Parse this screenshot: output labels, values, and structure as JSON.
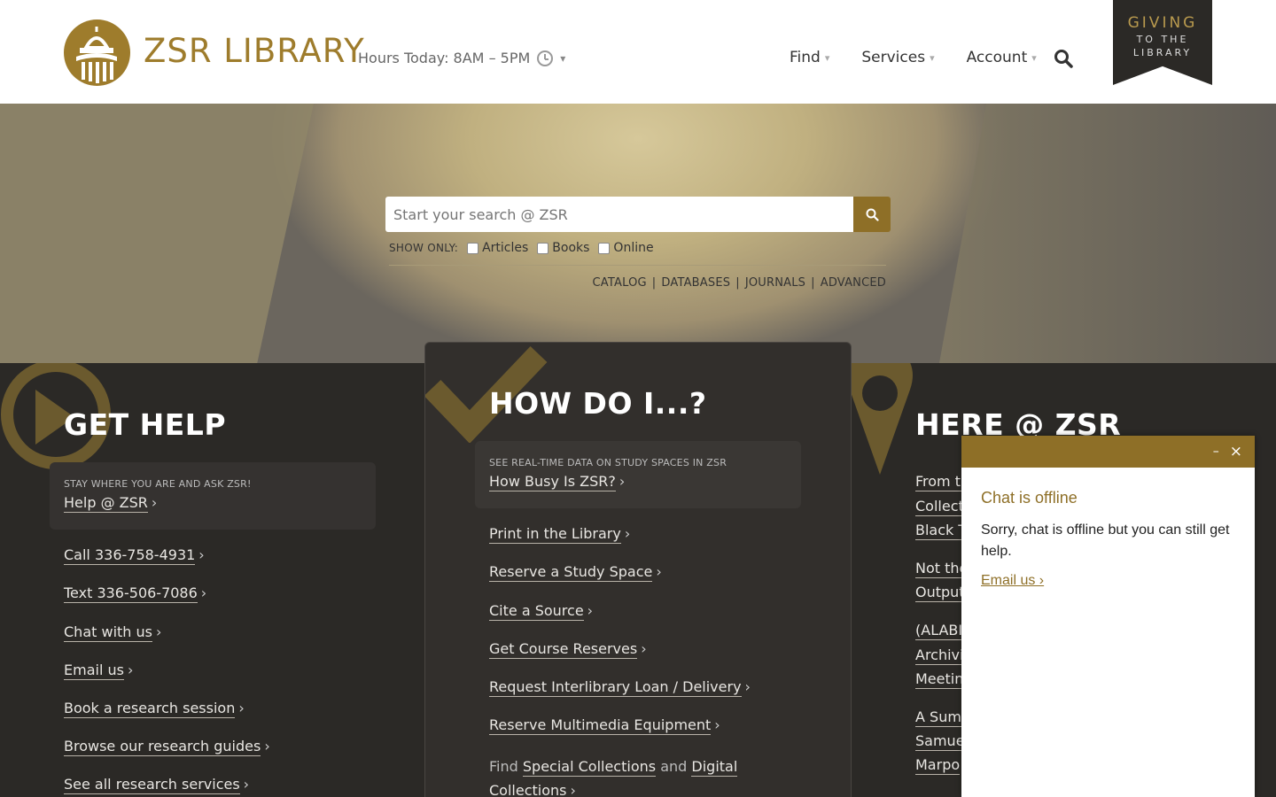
{
  "header": {
    "brand": "ZSR LIBRARY",
    "hours": "Hours Today: 8AM – 5PM",
    "nav": [
      {
        "label": "Find"
      },
      {
        "label": "Services"
      },
      {
        "label": "Account"
      }
    ],
    "giving": {
      "line1": "GIVING",
      "line2": "TO THE",
      "line3": "LIBRARY"
    }
  },
  "hero": {
    "search_placeholder": "Start your search @ ZSR",
    "show_only": "SHOW ONLY:",
    "filters": [
      "Articles",
      "Books",
      "Online"
    ],
    "links": [
      "CATALOG",
      "DATABASES",
      "JOURNALS",
      "ADVANCED"
    ],
    "separator": "|"
  },
  "get_help": {
    "title": "GET HELP",
    "card_small": "STAY WHERE YOU ARE AND ASK ZSR!",
    "card_link": "Help @ ZSR",
    "links": [
      "Call 336-758-4931",
      "Text 336-506-7086",
      "Chat with us",
      "Email us",
      "Book a research session",
      "Browse our research guides",
      "See all research services"
    ]
  },
  "how_do_i": {
    "title": "HOW DO I...?",
    "card_small": "SEE REAL-TIME DATA ON STUDY SPACES IN ZSR",
    "card_link": "How Busy Is ZSR?",
    "links": [
      "Print in the Library",
      "Reserve a Study Space",
      "Cite a Source",
      "Get Course Reserves",
      "Request Interlibrary Loan / Delivery",
      "Reserve Multimedia Equipment"
    ],
    "last": {
      "pre": "Find",
      "link1": "Special Collections",
      "mid": "and",
      "link2a": "Digital",
      "link2b": "Collections"
    }
  },
  "here_zsr": {
    "title": "HERE @ ZSR",
    "lines": [
      "From th",
      "Collecti",
      "Black T",
      "Not the",
      "Output",
      "(ALABI)",
      "Archivis",
      "Meetin",
      "A Summ",
      "Samue",
      "Marpo"
    ]
  },
  "chat": {
    "minimize": "–",
    "close": "×",
    "title": "Chat is offline",
    "message": "Sorry, chat is offline but you can still get help.",
    "email": "Email us ›"
  },
  "arrow": "›",
  "caret": "▾"
}
